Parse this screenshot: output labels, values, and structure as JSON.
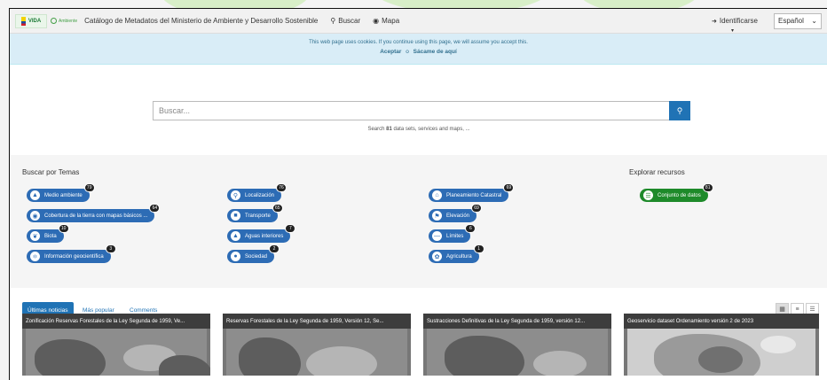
{
  "navbar": {
    "logo_main": "VIDA",
    "logo_sub": "Ambiente",
    "title": "Catálogo de Metadatos del Ministerio de Ambiente y Desarrollo Sostenible",
    "links": [
      {
        "label": "Buscar",
        "icon": "search-icon"
      },
      {
        "label": "Mapa",
        "icon": "globe-icon"
      }
    ],
    "signin_label": "Identificarse",
    "language": "Español"
  },
  "cookie": {
    "message": "This web page uses cookies. If you continue using this page, we will assume you accept this.",
    "accept": "Aceptar",
    "or": "o",
    "leave": "Sácame de aquí"
  },
  "search": {
    "placeholder": "Buscar...",
    "hint_prefix": "Search",
    "hint_count": "81",
    "hint_suffix": "data sets, services and maps, ..."
  },
  "topics": {
    "heading": "Buscar por Temas",
    "items": [
      {
        "label": "Medio ambiente",
        "count": "79",
        "icon": "tree-icon"
      },
      {
        "label": "Cobertura de la tierra con mapas básicos ...",
        "count": "64",
        "icon": "globe-icon"
      },
      {
        "label": "Biota",
        "count": "10",
        "icon": "leaf-icon"
      },
      {
        "label": "Información geocientífica",
        "count": "3",
        "icon": "atom-icon"
      },
      {
        "label": "Localización",
        "count": "76",
        "icon": "map-pin-icon"
      },
      {
        "label": "Transporte",
        "count": "65",
        "icon": "truck-icon"
      },
      {
        "label": "Aguas interiores",
        "count": "7",
        "icon": "water-drop-icon"
      },
      {
        "label": "Sociedad",
        "count": "2",
        "icon": "chat-icon"
      },
      {
        "label": "Planeamiento Catastral",
        "count": "69",
        "icon": "home-icon"
      },
      {
        "label": "Elevación",
        "count": "69",
        "icon": "flag-icon"
      },
      {
        "label": "Límites",
        "count": "6",
        "icon": "minus-icon"
      },
      {
        "label": "Agricultura",
        "count": "1",
        "icon": "sprout-icon"
      }
    ]
  },
  "resources": {
    "heading": "Explorar recursos",
    "items": [
      {
        "label": "Conjunto de datos",
        "count": "81",
        "icon": "database-icon"
      }
    ]
  },
  "tabs": [
    {
      "label": "Últimas noticias",
      "active": true
    },
    {
      "label": "Más popular",
      "active": false
    },
    {
      "label": "Comments",
      "active": false
    }
  ],
  "view_modes": [
    "grid-icon",
    "list-icon",
    "compact-list-icon"
  ],
  "cards": [
    {
      "title": "Zonificación Reservas Forestales de la Ley Segunda de 1959, Ve..."
    },
    {
      "title": "Reservas Forestales de la Ley Segunda de 1959, Versión 12, Se..."
    },
    {
      "title": "Sustracciones Definitivas de la Ley Segunda de 1959, versión 12..."
    },
    {
      "title": "Geoservicio dataset Ordenamiento versión 2 de 2023"
    }
  ],
  "colors": {
    "primary": "#2073b5",
    "pill": "#2d6cb5",
    "resource_pill": "#1e8a2a",
    "cookie_bg": "#d9edf7"
  }
}
